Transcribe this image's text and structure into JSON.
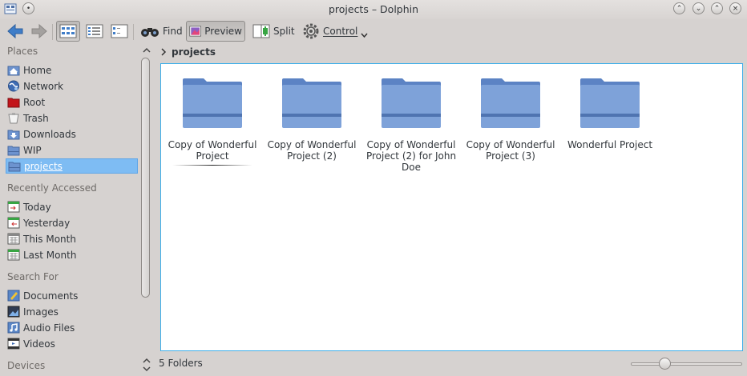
{
  "window": {
    "title": "projects – Dolphin",
    "buttons": {
      "restore": "⇱",
      "minimize": "⌄",
      "maximize": "⌃",
      "close": "×"
    }
  },
  "toolbar": {
    "find_label": "Find",
    "preview_label": "Preview",
    "split_label": "Split",
    "control_label": "Control"
  },
  "places": {
    "header": "Places",
    "items": [
      {
        "label": "Home",
        "icon": "home-icon"
      },
      {
        "label": "Network",
        "icon": "network-icon"
      },
      {
        "label": "Root",
        "icon": "root-folder-icon"
      },
      {
        "label": "Trash",
        "icon": "trash-icon"
      },
      {
        "label": "Downloads",
        "icon": "downloads-icon"
      },
      {
        "label": "WIP",
        "icon": "folder-icon"
      },
      {
        "label": "projects",
        "icon": "folder-icon",
        "selected": true
      }
    ]
  },
  "recent": {
    "header": "Recently Accessed",
    "items": [
      {
        "label": "Today",
        "icon": "calendar-icon"
      },
      {
        "label": "Yesterday",
        "icon": "calendar-icon"
      },
      {
        "label": "This Month",
        "icon": "calendar-icon"
      },
      {
        "label": "Last Month",
        "icon": "calendar-icon"
      }
    ]
  },
  "search": {
    "header": "Search For",
    "items": [
      {
        "label": "Documents",
        "icon": "documents-icon"
      },
      {
        "label": "Images",
        "icon": "images-icon"
      },
      {
        "label": "Audio Files",
        "icon": "audio-icon"
      },
      {
        "label": "Videos",
        "icon": "videos-icon"
      }
    ]
  },
  "devices": {
    "header": "Devices"
  },
  "breadcrumb": {
    "current": "projects"
  },
  "folders": [
    {
      "name": "Copy of Wonderful Project"
    },
    {
      "name": "Copy of Wonderful Project (2)"
    },
    {
      "name": "Copy of Wonderful Project (2) for John Doe"
    },
    {
      "name": "Copy of Wonderful Project (3)"
    },
    {
      "name": "Wonderful Project"
    }
  ],
  "status": {
    "text": "5 Folders"
  },
  "colors": {
    "accent": "#3daee9",
    "selection": "#7ebcf3",
    "folder": "#6d93cf"
  }
}
